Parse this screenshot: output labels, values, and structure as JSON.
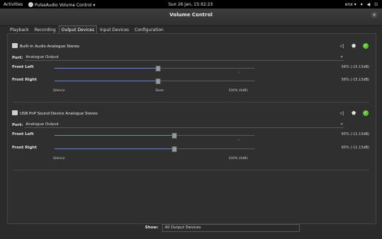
{
  "topbar": {
    "activities": "Activities",
    "app_menu": "PulseAudio Volume Control ▾",
    "clock": "Sun 26 Jan, 15:02:23",
    "lang": "enx ▾",
    "wifi_icon": "wifi-icon",
    "volume_icon": "volume-icon",
    "power_icon": "power-icon"
  },
  "window": {
    "title": "Volume Control",
    "close_label": "×"
  },
  "tabs": [
    {
      "label": "Playback"
    },
    {
      "label": "Recording"
    },
    {
      "label": "Output Devices",
      "active": true
    },
    {
      "label": "Input Devices"
    },
    {
      "label": "Configuration"
    }
  ],
  "devices": [
    {
      "name": "Built-in Audio Analogue Stereo",
      "port_label": "Port:",
      "port_value": "Analogue Output",
      "channels": [
        {
          "label": "Front Left",
          "value_text": "56% (-15.13dB)",
          "level": 0.56
        },
        {
          "label": "Front Right",
          "value_text": "56% (-15.13dB)",
          "level": 0.56
        }
      ],
      "scale": {
        "silence": "Silence",
        "base": "Base",
        "full": "100% (0dB)"
      }
    },
    {
      "name": "USB PnP Sound Device Analogue Stereo",
      "port_label": "Port:",
      "port_value": "Analogue Output",
      "channels": [
        {
          "label": "Front Left",
          "value_text": "65% (-11.13dB)",
          "level": 0.65
        },
        {
          "label": "Front Right",
          "value_text": "65% (-11.13dB)",
          "level": 0.65
        }
      ],
      "scale": {
        "silence": "Silence",
        "full": "100% (0dB)"
      }
    }
  ],
  "show": {
    "label": "Show:",
    "value": "All Output Devices"
  },
  "colors": {
    "accent": "#6a89c8",
    "default_check": "#5fbf2f"
  }
}
